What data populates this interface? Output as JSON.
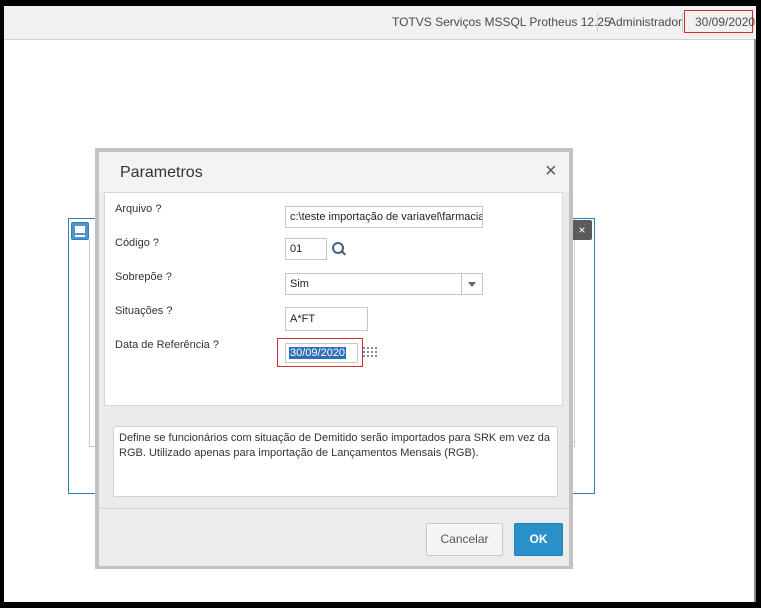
{
  "topbar": {
    "system_name": "TOTVS Serviços MSSQL Protheus 12.25",
    "user": "Administrador",
    "date": "30/09/2020"
  },
  "dialog": {
    "title": "Parametros",
    "close_glyph": "×",
    "fields": {
      "arquivo": {
        "label": "Arquivo ?",
        "value": "c:\\teste importação de variavel\\farmacia"
      },
      "codigo": {
        "label": "Código ?",
        "value": "01"
      },
      "sobrepoe": {
        "label": "Sobrepõe ?",
        "value": "Sim"
      },
      "situacoes": {
        "label": "Situações ?",
        "value": "A*FT"
      },
      "data_referencia": {
        "label": "Data de Referência ?",
        "value": "30/09/2020"
      }
    },
    "description": "Define se funcionários com situação de Demitido serão importados para SRK em vez da RGB. Utilizado apenas para importação de Lançamentos Mensais (RGB).",
    "buttons": {
      "cancel": "Cancelar",
      "ok": "OK"
    }
  },
  "background_window": {
    "close_glyph": "×"
  },
  "icons": {
    "search": "search-icon",
    "calendar": "calendar-icon",
    "dropdown": "chevron-down-icon",
    "window": "window-icon",
    "close": "close-icon"
  },
  "colors": {
    "highlight_border": "#d52b2b",
    "ok_button": "#2a90c8",
    "selection": "#2f6fb8"
  }
}
